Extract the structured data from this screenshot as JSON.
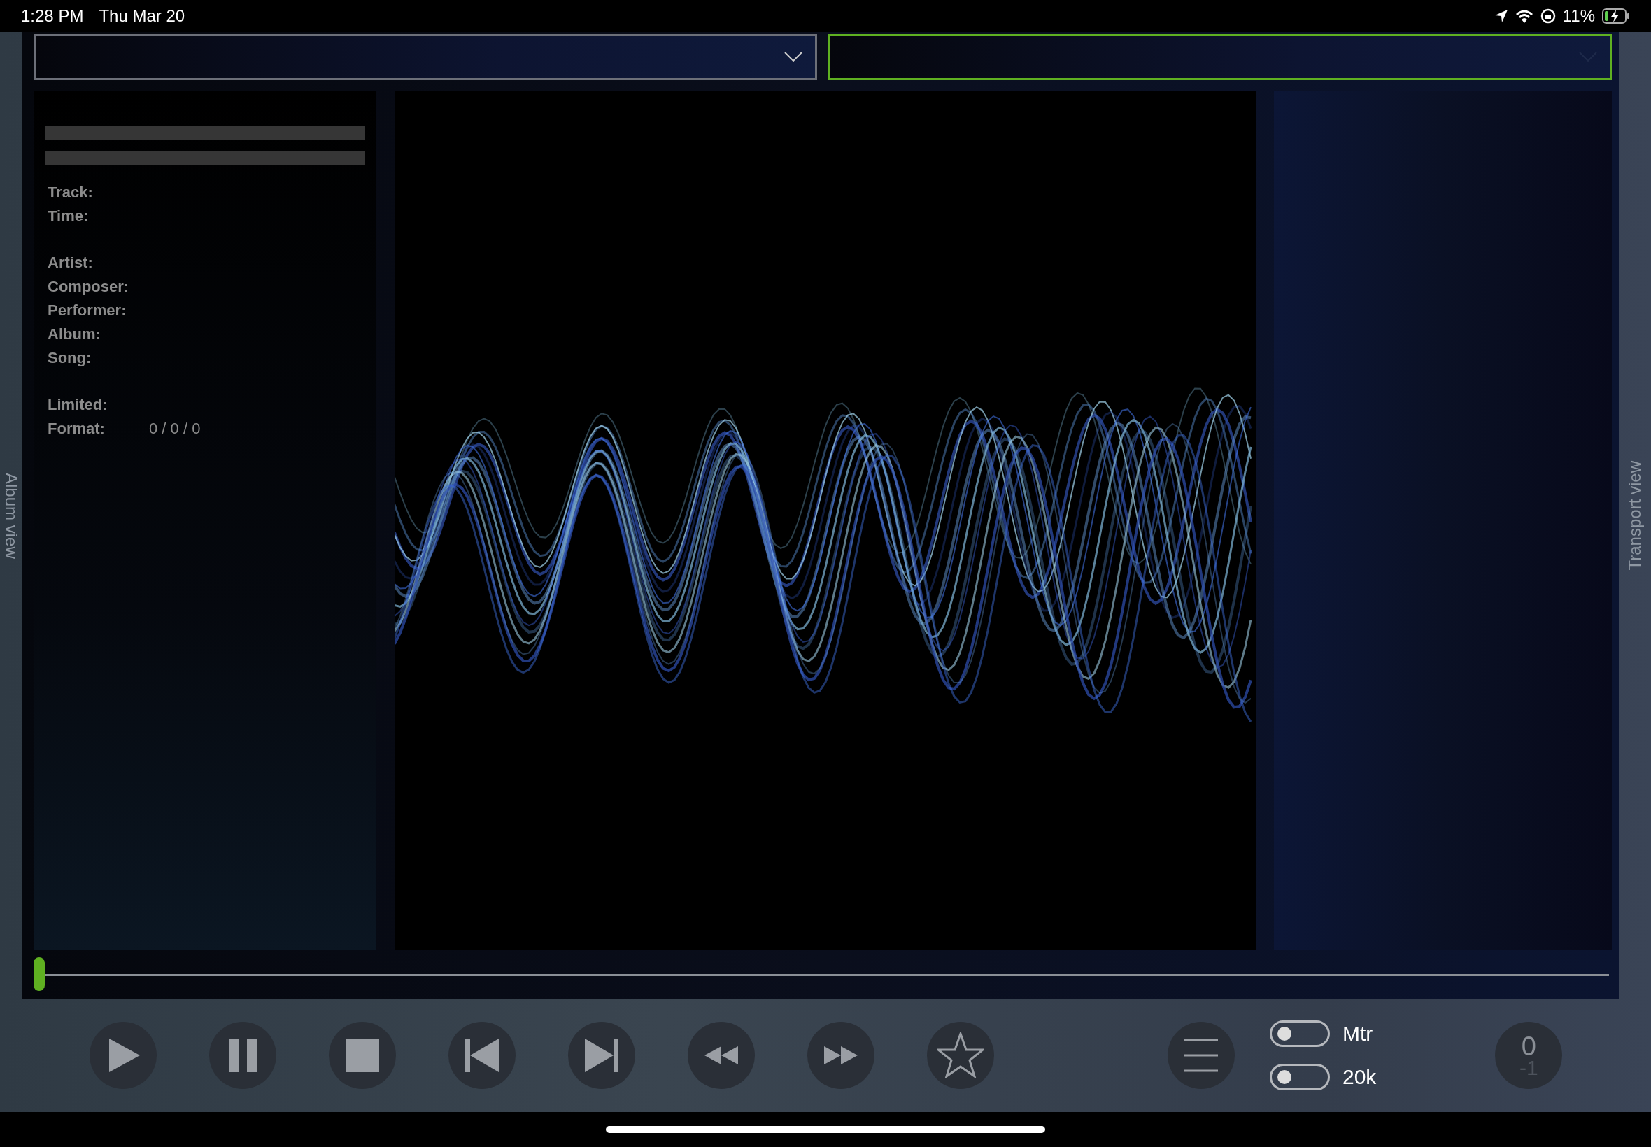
{
  "status_bar": {
    "time": "1:28 PM",
    "date": "Thu Mar 20",
    "battery": "11%"
  },
  "dropdowns": [
    {
      "selected": false
    },
    {
      "selected": true
    }
  ],
  "side_tabs": {
    "left": "Album view",
    "right": "Transport view"
  },
  "info_groups": [
    [
      {
        "label": "Track:"
      },
      {
        "label": "Time:"
      }
    ],
    [
      {
        "label": "Artist:"
      },
      {
        "label": "Composer:"
      },
      {
        "label": "Performer:"
      },
      {
        "label": "Album:"
      },
      {
        "label": "Song:"
      }
    ],
    [
      {
        "label": "Limited:"
      },
      {
        "label": "Format:",
        "value": "0 / 0 / 0"
      }
    ]
  ],
  "seek": {
    "level": 0
  },
  "transport_buttons": [
    {
      "kind": "play"
    },
    {
      "kind": "pause"
    },
    {
      "kind": "stop"
    },
    {
      "kind": "previous"
    },
    {
      "kind": "next"
    },
    {
      "kind": "rewind"
    },
    {
      "kind": "forward"
    },
    {
      "kind": "favorite"
    }
  ],
  "toggles": [
    {
      "label": "Mtr",
      "on": false
    },
    {
      "label": "20k",
      "on": false
    }
  ],
  "counter": {
    "value": "0",
    "sub": "-1"
  }
}
